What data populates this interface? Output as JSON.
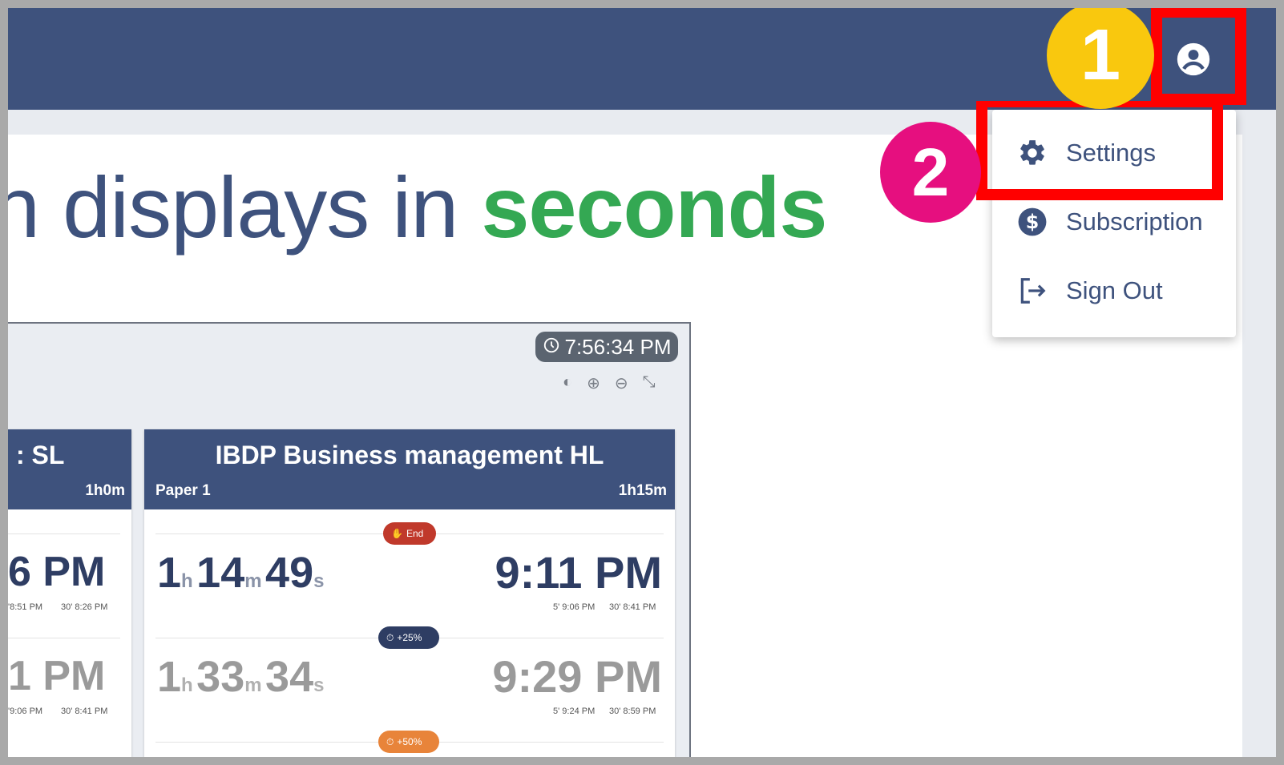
{
  "hero": {
    "text_before": "n displays in ",
    "text_highlight": "seconds"
  },
  "preview": {
    "clock": "7:56:34 PM",
    "left_card": {
      "title": ": SL",
      "duration": "1h0m",
      "time_1": "6 PM",
      "small_1a": "'8:51 PM",
      "small_1b": "30' 8:26 PM",
      "time_2": "1 PM",
      "small_2a": "'9:06 PM",
      "small_2b": "30' 8:41 PM"
    },
    "main_card": {
      "title": "IBDP Business management HL",
      "paper": "Paper 1",
      "duration": "1h15m",
      "end_label": "End",
      "countdown_1": {
        "h": "1",
        "m": "14",
        "s": "49"
      },
      "end_time_1": "9:11 PM",
      "small_1a": "5' 9:06 PM",
      "small_1b": "30' 8:41 PM",
      "extra_25": "+25%",
      "countdown_2": {
        "h": "1",
        "m": "33",
        "s": "34"
      },
      "end_time_2": "9:29 PM",
      "small_2a": "5' 9:24 PM",
      "small_2b": "30' 8:59 PM",
      "extra_50": "+50%"
    }
  },
  "menu": {
    "items": [
      {
        "label": "Settings",
        "icon": "gear-icon"
      },
      {
        "label": "Subscription",
        "icon": "dollar-icon"
      },
      {
        "label": "Sign Out",
        "icon": "sign-out-icon"
      }
    ]
  },
  "annotations": {
    "step1": "1",
    "step2": "2"
  },
  "colors": {
    "navy": "#3e527d",
    "green": "#34a853",
    "red": "#ff0000",
    "yellow": "#f9c80e",
    "pink": "#e60f7f"
  }
}
